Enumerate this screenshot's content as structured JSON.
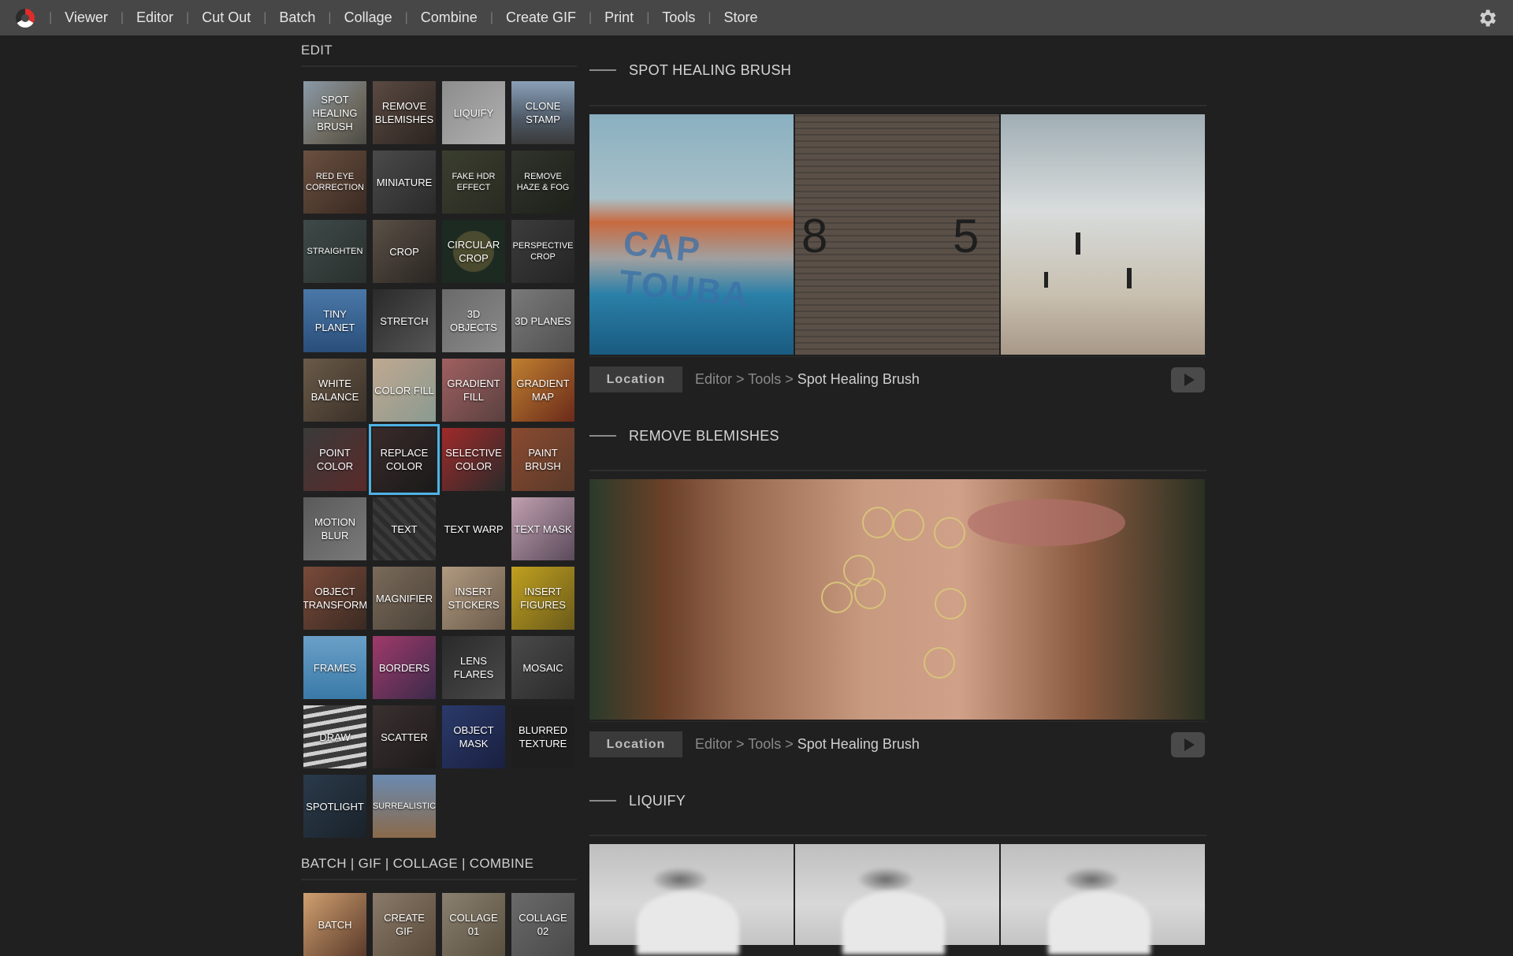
{
  "nav": {
    "items": [
      "Viewer",
      "Editor",
      "Cut Out",
      "Batch",
      "Collage",
      "Combine",
      "Create GIF",
      "Print",
      "Tools",
      "Store"
    ]
  },
  "sidebar": {
    "edit_title": "EDIT",
    "tiles": [
      {
        "label": "SPOT HEALING BRUSH",
        "bg": "linear-gradient(135deg,#8a9aa8,#6e6a60 60%,#4a4a44)"
      },
      {
        "label": "REMOVE BLEMISHES",
        "bg": "linear-gradient(135deg,#5a4a42,#2c2420)"
      },
      {
        "label": "LIQUIFY",
        "bg": "linear-gradient(135deg,#8d8d8d,#b0b0b0)"
      },
      {
        "label": "CLONE STAMP",
        "bg": "linear-gradient(180deg,#8aa0b8,#4e5966 60%,#3a3a3a)"
      },
      {
        "label": "RED EYE CORRECTION",
        "bg": "linear-gradient(135deg,#6a5040,#3a2a22)",
        "small": true
      },
      {
        "label": "MINIATURE",
        "bg": "linear-gradient(135deg,#4a4a4a,#2a2a2a)"
      },
      {
        "label": "FAKE HDR EFFECT",
        "bg": "linear-gradient(135deg,#3a3e2e,#2a2a22)",
        "small": true
      },
      {
        "label": "REMOVE HAZE & FOG",
        "bg": "linear-gradient(135deg,#30342c,#1e201a)",
        "small": true
      },
      {
        "label": "STRAIGHTEN",
        "bg": "linear-gradient(135deg,#3e4a48,#2a302e)",
        "small": true
      },
      {
        "label": "CROP",
        "bg": "linear-gradient(135deg,#5a5046,#2a2622)"
      },
      {
        "label": "CIRCULAR CROP",
        "bg": "radial-gradient(circle,#4a4a2e 45%,#1c2a22 47%)"
      },
      {
        "label": "PERSPECTIVE CROP",
        "bg": "linear-gradient(135deg,#3c3c3c,#242424)",
        "small": true
      },
      {
        "label": "TINY PLANET",
        "bg": "linear-gradient(180deg,#4a78a8,#2a4e7a)"
      },
      {
        "label": "STRETCH",
        "bg": "linear-gradient(135deg,#2a2a2a,#565656)"
      },
      {
        "label": "3D OBJECTS",
        "bg": "linear-gradient(135deg,#6a6a6a,#8a8a8a)"
      },
      {
        "label": "3D PLANES",
        "bg": "linear-gradient(135deg,#7a7a7a,#505050)"
      },
      {
        "label": "WHITE BALANCE",
        "bg": "linear-gradient(135deg,#6a5a48,#3a3028)"
      },
      {
        "label": "COLOR FILL",
        "bg": "linear-gradient(135deg,#c0a890,#8a9a90)"
      },
      {
        "label": "GRADIENT FILL",
        "bg": "linear-gradient(135deg,#a06060,#5a4040)"
      },
      {
        "label": "GRADIENT MAP",
        "bg": "linear-gradient(135deg,#c08030,#6a2a1a)"
      },
      {
        "label": "POINT COLOR",
        "bg": "linear-gradient(135deg,#3a3a3a,#5a2a2a)"
      },
      {
        "label": "REPLACE COLOR",
        "bg": "linear-gradient(135deg,#3a2a2a,#1a1a1a)",
        "selected": true
      },
      {
        "label": "SELECTIVE COLOR",
        "bg": "linear-gradient(135deg,#a02a2a,#2a2a2a)"
      },
      {
        "label": "PAINT BRUSH",
        "bg": "linear-gradient(135deg,#8a4a30,#5a3a2a)"
      },
      {
        "label": "MOTION BLUR",
        "bg": "linear-gradient(135deg,#5a5a5a,#7a7a7a)"
      },
      {
        "label": "TEXT",
        "bg": "repeating-linear-gradient(45deg,#3a3a3a 0 6px,#2c2c2c 6px 12px)"
      },
      {
        "label": "TEXT WARP",
        "bg": "radial-gradient(circle,#2e2e2e 1px,#202020 2px)"
      },
      {
        "label": "TEXT MASK",
        "bg": "linear-gradient(135deg,#c0a0b0,#5a4a5a)"
      },
      {
        "label": "OBJECT TRANSFORM",
        "bg": "linear-gradient(135deg,#7a4a3a,#3a2a22)"
      },
      {
        "label": "MAGNIFIER",
        "bg": "linear-gradient(135deg,#7a6a5a,#4a4238)"
      },
      {
        "label": "INSERT STICKERS",
        "bg": "linear-gradient(135deg,#b09a80,#6a5a4a)"
      },
      {
        "label": "INSERT FIGURES",
        "bg": "linear-gradient(135deg,#c0a020,#6a5a1a)"
      },
      {
        "label": "FRAMES",
        "bg": "linear-gradient(180deg,#6aa0c8,#3a7aa8)"
      },
      {
        "label": "BORDERS",
        "bg": "linear-gradient(135deg,#a03a6a,#3a2a4a)"
      },
      {
        "label": "LENS FLARES",
        "bg": "linear-gradient(135deg,#2a2a2a,#4a4a4a)"
      },
      {
        "label": "MOSAIC",
        "bg": "linear-gradient(135deg,#4a4a4a,#2a2a2a)"
      },
      {
        "label": "DRAW",
        "bg": "repeating-linear-gradient(170deg,#d0d0d0 0 5px,#3a3a3a 5px 12px)"
      },
      {
        "label": "SCATTER",
        "bg": "linear-gradient(135deg,#3a3030,#1e1a1a)"
      },
      {
        "label": "OBJECT MASK",
        "bg": "linear-gradient(135deg,#2a3a6a,#1a2040)"
      },
      {
        "label": "BLURRED TEXTURE",
        "bg": "radial-gradient(circle,#2a2a2a 1px,#1e1e1e 2px)"
      },
      {
        "label": "SPOTLIGHT",
        "bg": "linear-gradient(135deg,#2a3a4a,#1a222a)"
      },
      {
        "label": "SURREALISTIC",
        "bg": "linear-gradient(180deg,#6a8ab0,#8a6a4a)",
        "small": true
      }
    ],
    "section2_title": "BATCH | GIF | COLLAGE | COMBINE",
    "section2_tiles": [
      {
        "label": "BATCH",
        "bg": "linear-gradient(135deg,#d0a070,#5a3a2a)"
      },
      {
        "label": "CREATE GIF",
        "bg": "linear-gradient(135deg,#8a7a6a,#5a4a3a)"
      },
      {
        "label": "COLLAGE 01",
        "bg": "linear-gradient(135deg,#8a8070,#5a5040)"
      },
      {
        "label": "COLLAGE 02",
        "bg": "linear-gradient(135deg,#6a6a6a,#4a4a4a)"
      }
    ]
  },
  "content": {
    "sections": [
      {
        "title": "SPOT HEALING BRUSH",
        "location_label": "Location",
        "path_1": "Editor",
        "path_2": "Tools",
        "path_current": "Spot Healing Brush"
      },
      {
        "title": "REMOVE BLEMISHES",
        "location_label": "Location",
        "path_1": "Editor",
        "path_2": "Tools",
        "path_current": "Spot Healing Brush"
      },
      {
        "title": "LIQUIFY"
      }
    ],
    "boat_text": "CAP TOUBA",
    "wall_numbers": [
      "8",
      "5"
    ]
  }
}
